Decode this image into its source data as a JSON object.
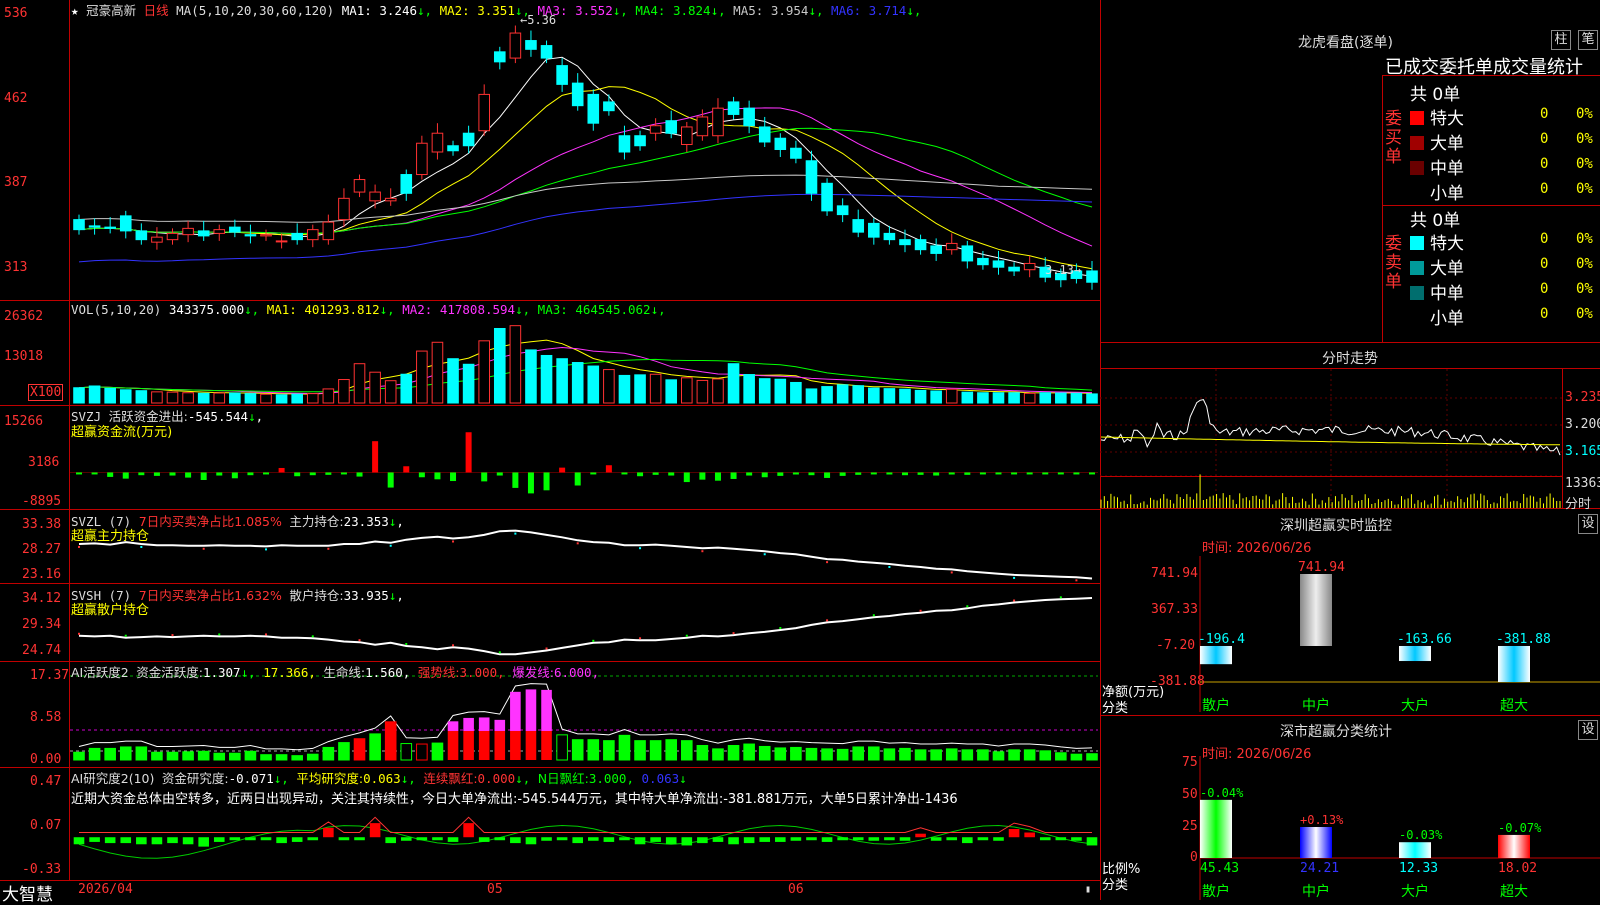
{
  "stock": {
    "name": "冠豪高新",
    "period": "日线",
    "star": "★"
  },
  "price_panel": {
    "ma_label": "MA(5,10,20,30,60,120)",
    "ma": [
      {
        "name": "MA1",
        "value": "3.246",
        "color": "#ffffff"
      },
      {
        "name": "MA2",
        "value": "3.351",
        "color": "#ffff00"
      },
      {
        "name": "MA3",
        "value": "3.552",
        "color": "#ff33ff"
      },
      {
        "name": "MA4",
        "value": "3.824",
        "color": "#00ff00"
      },
      {
        "name": "MA5",
        "value": "3.954",
        "color": "#c8c8c8"
      },
      {
        "name": "MA6",
        "value": "3.714",
        "color": "#3333ff"
      }
    ],
    "axis": [
      "536",
      "462",
      "387",
      "313"
    ],
    "high_label": "5.36",
    "low_label": "3.13"
  },
  "vol_panel": {
    "label": "VOL(5,10,20)",
    "value": "343375.000",
    "ma": [
      {
        "name": "MA1",
        "value": "401293.812",
        "color": "#ffff00"
      },
      {
        "name": "MA2",
        "value": "417808.594",
        "color": "#ff33ff"
      },
      {
        "name": "MA3",
        "value": "464545.062",
        "color": "#00ff00"
      }
    ],
    "axis": [
      "26362",
      "13018"
    ],
    "unit": "X100"
  },
  "svzj_panel": {
    "label": "SVZJ",
    "text": "活跃资金进出:",
    "value": "-545.544",
    "subtitle": "超赢资金流(万元)",
    "axis": [
      "15266",
      "3186",
      "-8895"
    ]
  },
  "svzl_panel": {
    "label": "SVZL (7)",
    "desc": "7日内买卖净占比1.085%",
    "text": "主力持仓:",
    "value": "23.353",
    "subtitle": "超赢主力持仓",
    "axis": [
      "33.38",
      "28.27",
      "23.16"
    ]
  },
  "svsh_panel": {
    "label": "SVSH (7)",
    "desc": "7日内买卖净占比1.632%",
    "text": "散户持仓:",
    "value": "33.935",
    "subtitle": "超赢散户持仓",
    "axis": [
      "34.12",
      "29.34",
      "24.74"
    ]
  },
  "ai_active_panel": {
    "label": "AI活跃度2",
    "t1": "资金活跃度:",
    "v1": "1.307",
    "v2": "17.366,",
    "t3": "生命线:",
    "v3": "1.560,",
    "t4": "强势线:",
    "v4": "3.000,",
    "t5": "爆发线:",
    "v5": "6.000,",
    "axis": [
      "17.37",
      "8.58",
      "0.00"
    ]
  },
  "ai_research_panel": {
    "label": "AI研究度2(10)",
    "t1": "资金研究度:",
    "v1": "-0.071",
    "t2": "平均研究度:",
    "v2": "0.063",
    "t3": "连续飘红:",
    "v3": "0.000",
    "t4": "N日飘红:",
    "v4": "3.000,",
    "v5": "0.063",
    "comment": "近期大资金总体由空转多，近两日出现异动，关注其持续性，今日大单净流出:-545.544万元，其中特大单净流出:-381.881万元，大单5日累计净出-1436",
    "axis": [
      "0.47",
      "0.07",
      "-0.33"
    ]
  },
  "dates": [
    "2026/04",
    "05",
    "06"
  ],
  "brand": "大智慧",
  "right": {
    "lhb_title": "龙虎看盘(逐单)",
    "btn_bar": "柱",
    "btn_pen": "笔",
    "tabs": [
      "已成交",
      "委托单",
      "成交量统计"
    ],
    "buy": {
      "side": [
        "委",
        "买",
        "单"
      ],
      "total": "共 0单",
      "rows": [
        {
          "label": "特大",
          "count": "0",
          "pct": "0%",
          "color": "#ff0000"
        },
        {
          "label": "大单",
          "count": "0",
          "pct": "0%",
          "color": "#a00000"
        },
        {
          "label": "中单",
          "count": "0",
          "pct": "0%",
          "color": "#6a0000"
        },
        {
          "label": "小单",
          "count": "0",
          "pct": "0%",
          "color": ""
        }
      ]
    },
    "sell": {
      "side": [
        "委",
        "卖",
        "单"
      ],
      "total": "共 0单",
      "rows": [
        {
          "label": "特大",
          "count": "0",
          "pct": "0%",
          "color": "#00ffff"
        },
        {
          "label": "大单",
          "count": "0",
          "pct": "0%",
          "color": "#009a9a"
        },
        {
          "label": "中单",
          "count": "0",
          "pct": "0%",
          "color": "#006e6e"
        },
        {
          "label": "小单",
          "count": "0",
          "pct": "0%",
          "color": ""
        }
      ]
    },
    "intraday": {
      "title": "分时走势",
      "axis": [
        "3.235",
        "3.200",
        "3.165"
      ],
      "vol": "13363",
      "vol_label": "分时"
    },
    "sz_monitor": {
      "title": "深圳超赢实时监控",
      "btn": "设",
      "date_label": "时间: 2026/06/26",
      "axis": [
        "741.94",
        "367.33",
        "-7.20",
        "-381.88"
      ],
      "net_label": "净额(万元)",
      "cat_label": "分类",
      "categories": [
        "散户",
        "中户",
        "大户",
        "超大"
      ],
      "values": [
        -196.4,
        741.94,
        -163.66,
        -381.88
      ],
      "value_labels": [
        "-196.4",
        "741.94",
        "-163.66",
        "-381.88"
      ]
    },
    "sz_stats": {
      "title": "深市超赢分类统计",
      "btn": "设",
      "date_label": "时间: 2026/06/26",
      "axis": [
        "75",
        "50",
        "25",
        "0"
      ],
      "ratio_label": "比例%",
      "cat_label": "分类",
      "categories": [
        "散户",
        "中户",
        "大户",
        "超大"
      ],
      "values": [
        45.43,
        24.21,
        12.33,
        18.02
      ],
      "value_labels": [
        "45.43",
        "24.21",
        "12.33",
        "18.02"
      ],
      "change_labels": [
        "-0.04%",
        "+0.13%",
        "-0.03%",
        "-0.07%"
      ]
    }
  },
  "chart_data": [
    {
      "type": "candlestick",
      "name": "冠豪高新 日线",
      "ylim": [
        3.1,
        5.4
      ],
      "open": [
        3.71,
        3.66,
        3.65,
        3.74,
        3.62,
        3.53,
        3.55,
        3.59,
        3.62,
        3.6,
        3.65,
        3.59,
        3.58,
        3.54,
        3.6,
        3.55,
        3.55,
        3.71,
        3.93,
        3.86,
        3.86,
        4.07,
        4.07,
        4.25,
        4.3,
        4.4,
        4.42,
        5.05,
        5.0,
        5.14,
        5.1,
        4.94,
        4.8,
        4.71,
        4.65,
        4.38,
        4.38,
        4.4,
        4.5,
        4.31,
        4.38,
        4.38,
        4.65,
        4.6,
        4.45,
        4.36,
        4.28,
        4.18,
        4.0,
        3.82,
        3.71,
        3.68,
        3.6,
        3.55,
        3.55,
        3.5,
        3.47,
        3.5,
        3.4,
        3.38,
        3.33,
        3.31,
        3.33,
        3.28,
        3.3,
        3.3
      ],
      "close": [
        3.63,
        3.65,
        3.64,
        3.62,
        3.55,
        3.57,
        3.6,
        3.64,
        3.58,
        3.63,
        3.61,
        3.58,
        3.59,
        3.54,
        3.55,
        3.63,
        3.69,
        3.88,
        4.03,
        3.93,
        3.88,
        3.92,
        4.32,
        4.4,
        4.26,
        4.3,
        4.71,
        4.97,
        5.2,
        5.07,
        5.0,
        4.79,
        4.62,
        4.48,
        4.58,
        4.25,
        4.3,
        4.46,
        4.4,
        4.45,
        4.53,
        4.6,
        4.55,
        4.46,
        4.33,
        4.27,
        4.2,
        3.92,
        3.78,
        3.75,
        3.61,
        3.57,
        3.55,
        3.51,
        3.47,
        3.44,
        3.52,
        3.38,
        3.35,
        3.33,
        3.3,
        3.36,
        3.25,
        3.23,
        3.24,
        3.21
      ]
    },
    {
      "type": "bar",
      "name": "VOL",
      "ylim": [
        0,
        30000
      ],
      "values": [
        5200,
        5800,
        5000,
        4500,
        4200,
        3800,
        3700,
        3500,
        3300,
        3400,
        3400,
        3200,
        3000,
        2800,
        3000,
        3200,
        4800,
        8000,
        13400,
        10500,
        7600,
        9800,
        17700,
        20700,
        15100,
        13200,
        21200,
        25400,
        26362,
        18100,
        16200,
        15100,
        13800,
        12600,
        11400,
        9400,
        9600,
        9800,
        7900,
        8600,
        7700,
        8200,
        13400,
        9700,
        8300,
        8100,
        7000,
        4800,
        5600,
        6200,
        5900,
        5100,
        4900,
        4700,
        4300,
        4100,
        4700,
        3700,
        3500,
        3500,
        3500,
        3300,
        3500,
        3400,
        3300,
        3100
      ],
      "up": [
        false,
        false,
        false,
        false,
        false,
        true,
        true,
        true,
        false,
        true,
        false,
        false,
        true,
        false,
        false,
        true,
        true,
        true,
        true,
        true,
        true,
        false,
        true,
        true,
        false,
        false,
        true,
        false,
        true,
        false,
        false,
        false,
        false,
        false,
        true,
        false,
        false,
        true,
        false,
        true,
        true,
        true,
        false,
        false,
        false,
        false,
        false,
        false,
        false,
        false,
        false,
        false,
        false,
        false,
        false,
        false,
        true,
        false,
        false,
        false,
        false,
        true,
        false,
        false,
        false,
        false
      ]
    },
    {
      "type": "bar",
      "name": "超赢资金流(万元)",
      "ylim": [
        -8895,
        15266
      ],
      "values": [
        -400,
        -300,
        -1300,
        -1800,
        -800,
        -1000,
        -900,
        -1500,
        -2200,
        -900,
        -1700,
        -800,
        -500,
        1300,
        -1100,
        -800,
        -700,
        -500,
        -1200,
        9100,
        -4400,
        1800,
        -1400,
        -2000,
        -2500,
        11700,
        -2600,
        -900,
        -4500,
        -6100,
        -5200,
        1400,
        -3800,
        -500,
        2100,
        -500,
        -1100,
        -700,
        -900,
        -2800,
        -2100,
        -2400,
        -1900,
        -900,
        -1400,
        -1000,
        -600,
        -800,
        -1600,
        -1000,
        -700,
        -500,
        -600,
        -800,
        -700,
        -900,
        -600,
        -700,
        -400,
        -300,
        -500,
        -300,
        -500,
        -400,
        -300,
        -545
      ]
    },
    {
      "type": "line",
      "name": "主力持仓",
      "ylim": [
        23.16,
        33.38
      ],
      "values": [
        29.1,
        29.2,
        29.0,
        29.4,
        29.1,
        28.9,
        28.9,
        28.8,
        28.8,
        28.9,
        28.8,
        28.8,
        28.7,
        28.9,
        28.8,
        28.8,
        28.8,
        29.1,
        29.1,
        29.5,
        29.3,
        29.8,
        30.1,
        30.3,
        30.0,
        30.2,
        30.6,
        31.2,
        31.3,
        31.0,
        30.6,
        30.2,
        29.7,
        29.4,
        29.3,
        28.9,
        28.9,
        29.0,
        28.8,
        28.6,
        28.4,
        28.5,
        28.3,
        28.1,
        27.9,
        27.6,
        27.4,
        27.0,
        26.6,
        26.5,
        26.2,
        26.0,
        25.8,
        25.5,
        25.3,
        25.0,
        24.9,
        24.6,
        24.4,
        24.2,
        24.0,
        23.9,
        23.8,
        23.7,
        23.6,
        23.4
      ]
    },
    {
      "type": "line",
      "name": "散户持仓",
      "ylim": [
        24.74,
        34.12
      ],
      "values": [
        27.9,
        27.8,
        27.9,
        27.6,
        27.7,
        27.8,
        27.7,
        27.8,
        27.9,
        27.8,
        27.8,
        27.9,
        27.8,
        27.6,
        27.6,
        27.5,
        27.3,
        27.0,
        26.9,
        26.5,
        26.8,
        26.3,
        26.1,
        25.8,
        26.1,
        25.9,
        25.5,
        25.0,
        25.0,
        25.3,
        25.6,
        26.0,
        26.4,
        26.8,
        26.9,
        27.3,
        27.2,
        27.2,
        27.4,
        27.6,
        27.9,
        27.8,
        28.0,
        28.3,
        28.5,
        28.8,
        29.1,
        29.6,
        30.0,
        30.2,
        30.5,
        30.8,
        31.0,
        31.3,
        31.5,
        31.8,
        31.9,
        32.2,
        32.6,
        32.8,
        33.1,
        33.3,
        33.5,
        33.6,
        33.7,
        33.8
      ]
    },
    {
      "type": "bar",
      "name": "资金活跃度",
      "ylim": [
        0,
        17.37
      ],
      "values": [
        1.6,
        2.4,
        2.4,
        2.7,
        2.7,
        1.6,
        1.6,
        1.7,
        1.8,
        1.4,
        1.4,
        1.8,
        1.1,
        1.1,
        0.9,
        1.2,
        2.6,
        3.6,
        4.4,
        5.4,
        7.9,
        3.4,
        3.3,
        3.5,
        8.0,
        8.7,
        8.8,
        8.3,
        14.1,
        14.6,
        14.5,
        5.2,
        4.2,
        4.2,
        4.0,
        5.1,
        4.0,
        4.0,
        4.2,
        4.0,
        3.0,
        2.3,
        3.0,
        3.3,
        2.8,
        2.5,
        2.6,
        2.4,
        2.3,
        2.2,
        2.7,
        2.7,
        2.3,
        2.4,
        2.1,
        2.1,
        2.3,
        2.1,
        2.1,
        1.7,
        2.1,
        2.1,
        1.9,
        1.5,
        1.2,
        1.3
      ]
    },
    {
      "type": "bar",
      "name": "资金研究度",
      "ylim": [
        -0.33,
        0.47
      ],
      "values": [
        -0.06,
        -0.04,
        -0.05,
        -0.05,
        -0.06,
        -0.06,
        -0.05,
        -0.06,
        -0.08,
        -0.04,
        -0.02,
        -0.01,
        -0.02,
        -0.05,
        -0.04,
        -0.02,
        0.08,
        -0.01,
        -0.01,
        0.12,
        -0.05,
        -0.03,
        -0.02,
        -0.01,
        -0.04,
        0.12,
        -0.04,
        -0.02,
        -0.05,
        -0.06,
        -0.03,
        -0.01,
        -0.05,
        -0.03,
        -0.04,
        -0.02,
        -0.06,
        -0.04,
        -0.06,
        -0.07,
        -0.05,
        -0.04,
        -0.06,
        -0.05,
        -0.04,
        -0.04,
        -0.03,
        -0.02,
        -0.04,
        -0.02,
        -0.02,
        -0.03,
        -0.02,
        -0.03,
        0.03,
        -0.03,
        -0.02,
        -0.05,
        -0.02,
        -0.03,
        0.07,
        0.04,
        -0.02,
        -0.02,
        -0.03,
        -0.07
      ]
    }
  ]
}
